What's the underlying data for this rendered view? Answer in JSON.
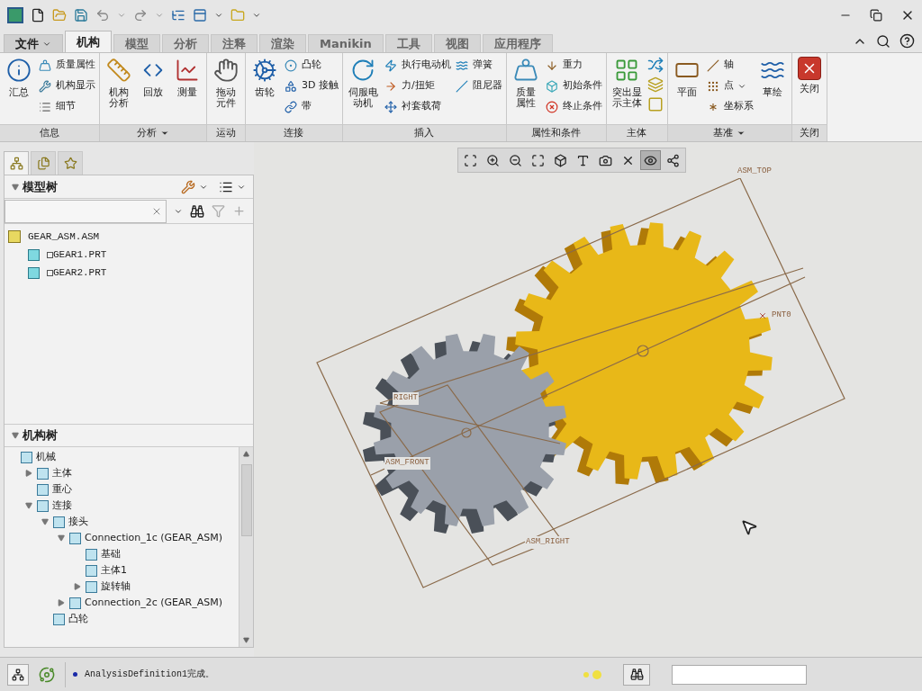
{
  "menu_tabs": [
    {
      "label": "文件",
      "dropdown": true,
      "selected": false,
      "kind": "file"
    },
    {
      "label": "机构",
      "dropdown": false,
      "selected": true,
      "kind": "tab"
    },
    {
      "label": "模型",
      "dropdown": false,
      "selected": false,
      "kind": "tab"
    },
    {
      "label": "分析",
      "dropdown": false,
      "selected": false,
      "kind": "tab"
    },
    {
      "label": "注释",
      "dropdown": false,
      "selected": false,
      "kind": "tab"
    },
    {
      "label": "渲染",
      "dropdown": false,
      "selected": false,
      "kind": "tab"
    },
    {
      "label": "Manikin",
      "dropdown": false,
      "selected": false,
      "kind": "tab"
    },
    {
      "label": "工具",
      "dropdown": false,
      "selected": false,
      "kind": "tab"
    },
    {
      "label": "视图",
      "dropdown": false,
      "selected": false,
      "kind": "tab"
    },
    {
      "label": "应用程序",
      "dropdown": false,
      "selected": false,
      "kind": "tab"
    }
  ],
  "ribbon_groups": [
    {
      "label": "信息",
      "dropdown": false,
      "items": [
        {
          "kind": "large",
          "label": "汇总"
        },
        {
          "kind": "small",
          "label": "质量属性"
        },
        {
          "kind": "small",
          "label": "机构显示"
        },
        {
          "kind": "small",
          "label": "细节"
        }
      ]
    },
    {
      "label": "分析",
      "dropdown": true,
      "items": [
        {
          "kind": "large",
          "label": "机构分析"
        },
        {
          "kind": "large",
          "label": "回放"
        },
        {
          "kind": "large",
          "label": "测量"
        }
      ]
    },
    {
      "label": "运动",
      "dropdown": false,
      "items": [
        {
          "kind": "large",
          "label": "拖动元件"
        }
      ]
    },
    {
      "label": "连接",
      "dropdown": false,
      "items": [
        {
          "kind": "large",
          "label": "齿轮"
        },
        {
          "kind": "small",
          "label": "凸轮"
        },
        {
          "kind": "small",
          "label": "3D 接触"
        },
        {
          "kind": "small",
          "label": "带"
        }
      ]
    },
    {
      "label": "插入",
      "dropdown": false,
      "items": [
        {
          "kind": "large",
          "label": "伺服电动机"
        },
        {
          "kind": "small",
          "label": "执行电动机"
        },
        {
          "kind": "small",
          "label": "力/扭矩"
        },
        {
          "kind": "small",
          "label": "衬套载荷"
        },
        {
          "kind": "small",
          "label": "弹簧"
        },
        {
          "kind": "small",
          "label": "阻尼器"
        }
      ]
    },
    {
      "label": "属性和条件",
      "dropdown": false,
      "items": [
        {
          "kind": "large",
          "label": "质量属性"
        },
        {
          "kind": "small",
          "label": "重力"
        },
        {
          "kind": "small",
          "label": "初始条件"
        },
        {
          "kind": "small",
          "label": "终止条件"
        }
      ]
    },
    {
      "label": "主体",
      "dropdown": false,
      "items": [
        {
          "kind": "large",
          "label": "突出显示主体"
        },
        {
          "kind": "icon"
        },
        {
          "kind": "icon"
        },
        {
          "kind": "icon"
        }
      ]
    },
    {
      "label": "基准",
      "dropdown": true,
      "items": [
        {
          "kind": "large",
          "label": "平面"
        },
        {
          "kind": "small",
          "label": "轴"
        },
        {
          "kind": "small",
          "label": "点",
          "dropdown": true
        },
        {
          "kind": "small",
          "label": "坐标系"
        },
        {
          "kind": "large",
          "label": "草绘"
        }
      ]
    },
    {
      "label": "关闭",
      "dropdown": false,
      "items": [
        {
          "kind": "large",
          "label": "关闭"
        }
      ]
    }
  ],
  "panel_tabs": [
    {
      "selected": true
    },
    {
      "selected": false
    },
    {
      "selected": false
    }
  ],
  "model_tree": {
    "title": "模型树",
    "items": [
      {
        "label": "GEAR_ASM.ASM",
        "kind": "assembly",
        "children": [
          {
            "label": "GEAR1.PRT",
            "kind": "part"
          },
          {
            "label": "GEAR2.PRT",
            "kind": "part"
          }
        ]
      }
    ]
  },
  "mechanism_tree": {
    "title": "机构树",
    "items": [
      {
        "label": "机械",
        "children": [
          {
            "label": "主体",
            "expanded": false
          },
          {
            "label": "重心"
          },
          {
            "label": "连接",
            "expanded": true,
            "children": [
              {
                "label": "接头",
                "expanded": true,
                "children": [
                  {
                    "label": "Connection_1c (GEAR_ASM)",
                    "expanded": true,
                    "children": [
                      {
                        "label": "基础"
                      },
                      {
                        "label": "主体1"
                      },
                      {
                        "label": "旋转轴",
                        "expanded": false
                      }
                    ]
                  },
                  {
                    "label": "Connection_2c (GEAR_ASM)",
                    "expanded": false
                  }
                ]
              },
              {
                "label": "凸轮"
              }
            ]
          }
        ]
      }
    ]
  },
  "viewport_toolbar": [
    {
      "selected": false
    },
    {
      "selected": false
    },
    {
      "selected": false
    },
    {
      "selected": false
    },
    {
      "selected": false
    },
    {
      "selected": false
    },
    {
      "selected": false
    },
    {
      "selected": false
    },
    {
      "selected": true
    },
    {
      "selected": false
    }
  ],
  "viewport_labels": [
    {
      "label": "ASM_TOP",
      "kind": "plane"
    },
    {
      "label": "PNT0",
      "kind": "point"
    },
    {
      "label": "RIGHT",
      "kind": "plane"
    },
    {
      "label": "ASM_FRONT",
      "kind": "plane"
    },
    {
      "label": "ASM_RIGHT",
      "kind": "plane"
    }
  ],
  "status_bar": {
    "message": "AnalysisDefinition1完成。"
  }
}
